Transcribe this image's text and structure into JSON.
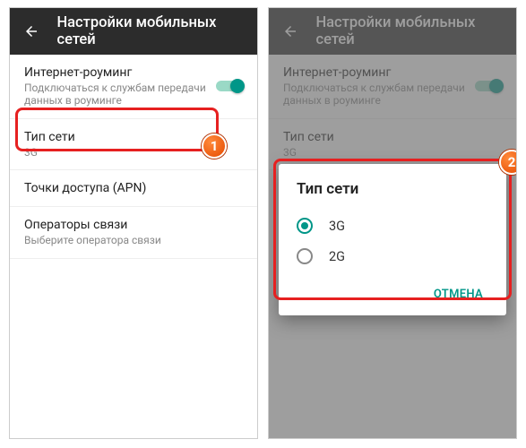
{
  "appbar": {
    "title": "Настройки мобильных сетей"
  },
  "items": {
    "roaming": {
      "title": "Интернет-роуминг",
      "subtitle": "Подключаться к службам передачи данных в роуминге"
    },
    "network_type": {
      "title": "Тип сети",
      "subtitle": "3G"
    },
    "apn": {
      "title": "Точки доступа (APN)"
    },
    "operators": {
      "title": "Операторы связи",
      "subtitle": "Выберите оператора связи"
    }
  },
  "dialog": {
    "title": "Тип сети",
    "options": {
      "o1": "3G",
      "o2": "2G"
    },
    "cancel": "ОТМЕНА"
  },
  "badges": {
    "b1": "1",
    "b2": "2"
  }
}
